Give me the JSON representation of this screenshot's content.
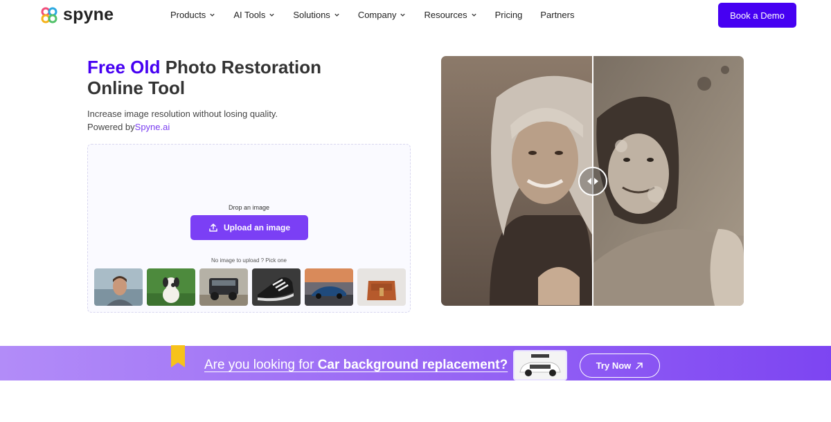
{
  "header": {
    "logo_text": "spyne",
    "nav": [
      {
        "label": "Products",
        "has_dropdown": true
      },
      {
        "label": "AI Tools",
        "has_dropdown": true
      },
      {
        "label": "Solutions",
        "has_dropdown": true
      },
      {
        "label": "Company",
        "has_dropdown": true
      },
      {
        "label": "Resources",
        "has_dropdown": true
      },
      {
        "label": "Pricing",
        "has_dropdown": false
      },
      {
        "label": "Partners",
        "has_dropdown": false
      }
    ],
    "cta_label": "Book a Demo"
  },
  "hero": {
    "title_accent": "Free Old",
    "title_rest": " Photo Restoration Online Tool",
    "subtitle": "Increase image resolution without losing quality.",
    "powered_prefix": "Powered by",
    "powered_link": "Spyne.ai"
  },
  "uploader": {
    "drop_label": "Drop an image",
    "upload_label": "Upload an image",
    "pick_label": "No image to upload ? Pick one",
    "samples": [
      "man-portrait",
      "puppy",
      "jeep",
      "sneaker",
      "sports-car",
      "handbag"
    ]
  },
  "banner": {
    "text_prefix": "Are you looking for ",
    "text_bold": "Car background replacement?",
    "try_label": "Try Now"
  },
  "colors": {
    "brand": "#4600f2",
    "upload_button": "#7b3ff5",
    "link": "#7a3ef0"
  }
}
